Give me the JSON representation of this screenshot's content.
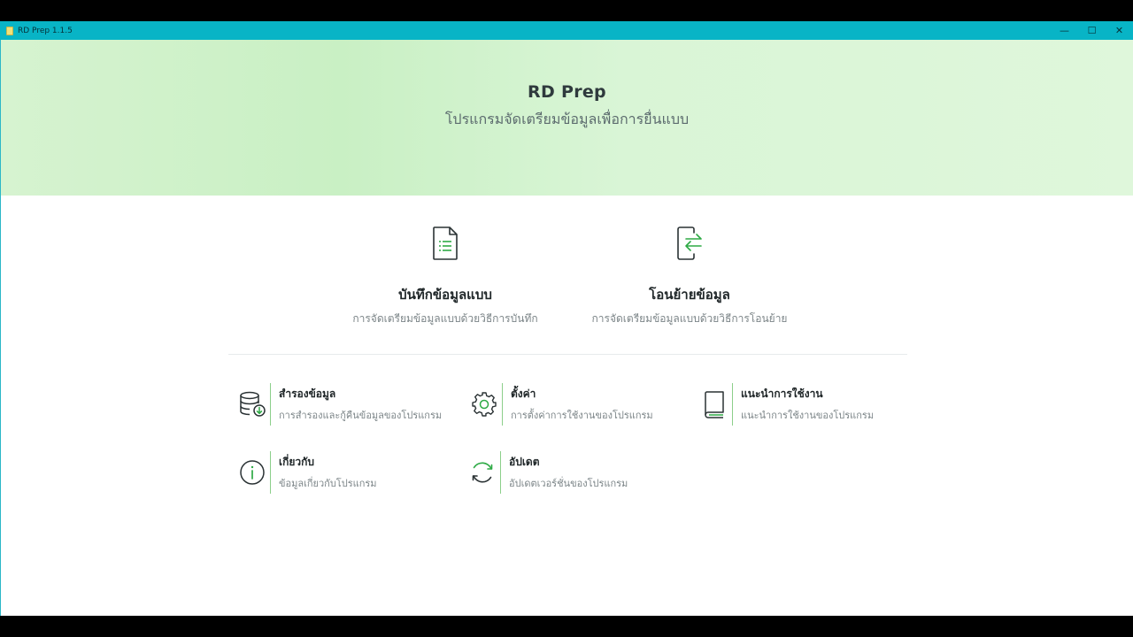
{
  "window": {
    "title": "RD Prep 1.1.5",
    "controls": {
      "minimize": "—",
      "maximize": "☐",
      "close": "✕"
    }
  },
  "hero": {
    "title": "RD Prep",
    "subtitle": "โปรแกรมจัดเตรียมข้อมูลเพื่อการยื่นแบบ"
  },
  "main_actions": [
    {
      "title": "บันทึกข้อมูลแบบ",
      "description": "การจัดเตรียมข้อมูลแบบด้วยวิธีการบันทึก",
      "icon": "document-list-icon"
    },
    {
      "title": "โอนย้ายข้อมูล",
      "description": "การจัดเตรียมข้อมูลแบบด้วยวิธีการโอนย้าย",
      "icon": "transfer-icon"
    }
  ],
  "tools": [
    {
      "title": "สำรองข้อมูล",
      "description": "การสำรองและกู้คืนข้อมูลของโปรแกรม",
      "icon": "database-backup-icon"
    },
    {
      "title": "ตั้งค่า",
      "description": "การตั้งค่าการใช้งานของโปรแกรม",
      "icon": "gear-icon"
    },
    {
      "title": "แนะนำการใช้งาน",
      "description": "แนะนำการใช้งานของโปรแกรม",
      "icon": "book-icon"
    },
    {
      "title": "เกี่ยวกับ",
      "description": "ข้อมูลเกี่ยวกับโปรแกรม",
      "icon": "info-icon"
    },
    {
      "title": "อัปเดต",
      "description": "อัปเดตเวอร์ชั่นของโปรแกรม",
      "icon": "refresh-icon"
    }
  ],
  "colors": {
    "titlebar": "#08b4c6",
    "accent_green": "#2eaa45",
    "hero_bg": "#d6f3d0"
  }
}
